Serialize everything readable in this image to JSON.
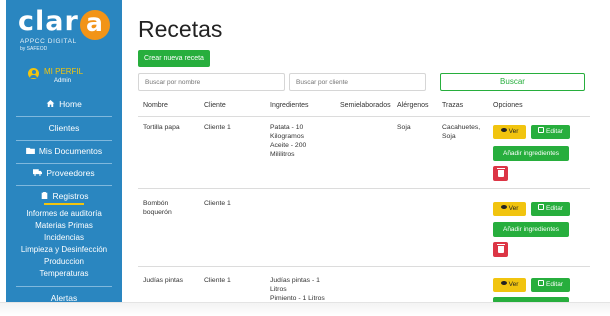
{
  "brand": {
    "logo_word": "clar",
    "logo_letter": "a",
    "tagline": "APPCC DIGITAL",
    "by_line": "by SAFEOD",
    "accent_color": "#f29417",
    "sidebar_color": "#2a86c0"
  },
  "profile": {
    "name": "MI PERFIL",
    "role": "Admin"
  },
  "nav": {
    "home": "Home",
    "clientes": "Clientes",
    "documentos": "Mis Documentos",
    "proveedores": "Proveedores",
    "registros": "Registros",
    "sub_items": [
      "Informes de auditoría",
      "Materias Primas",
      "Incidencias",
      "Limpieza y Desinfección",
      "Produccion",
      "Temperaturas"
    ],
    "alertas": "Alertas"
  },
  "page": {
    "title": "Recetas",
    "create_button": "Crear nueva receta",
    "search_name_placeholder": "Buscar por nombre",
    "search_client_placeholder": "Buscar por cliente",
    "search_button": "Buscar"
  },
  "table": {
    "headers": [
      "Nombre",
      "Cliente",
      "Ingredientes",
      "Semielaborados",
      "Alérgenos",
      "Trazas",
      "Opciones"
    ],
    "rows": [
      {
        "nombre": "Tortilla papa",
        "cliente": "Cliente 1",
        "ingredientes": [
          "Patata - 10",
          "Kilogramos",
          "Aceite - 200",
          "Mililitros"
        ],
        "semielaborados": "",
        "alergenos": "Soja",
        "trazas": [
          "Cacahuetes,",
          "Soja"
        ]
      },
      {
        "nombre": [
          "Bombón",
          "boquerón"
        ],
        "cliente": "Cliente 1",
        "ingredientes": [],
        "semielaborados": "",
        "alergenos": "",
        "trazas": []
      },
      {
        "nombre": "Judías pintas",
        "cliente": "Cliente 1",
        "ingredientes": [
          "Judías pintas - 1",
          "Litros",
          "Pimiento - 1 Litros"
        ],
        "semielaborados": "",
        "alergenos": "",
        "trazas": []
      }
    ],
    "buttons": {
      "ver": "Ver",
      "editar": "Editar",
      "ingredientes": "Añadir ingredientes"
    }
  }
}
